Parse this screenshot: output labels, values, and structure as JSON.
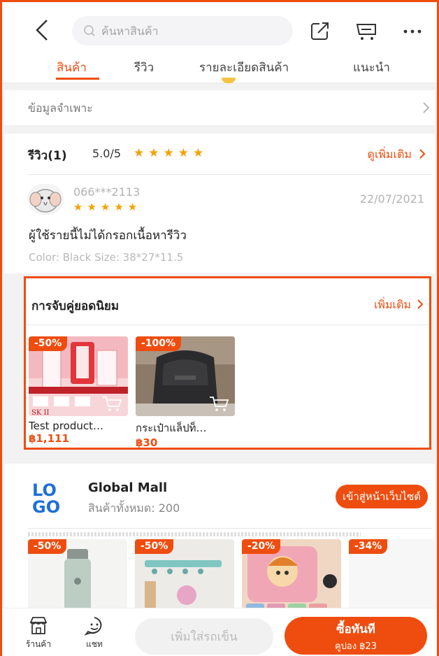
{
  "header": {
    "search_placeholder": "ค้นหาสินค้า",
    "tabs": [
      {
        "label": "สินค้า",
        "active": true
      },
      {
        "label": "รีวิว",
        "active": false
      },
      {
        "label": "รายละเอียดสินค้า",
        "active": false
      },
      {
        "label": "แนะนำ",
        "active": false
      }
    ]
  },
  "specs": {
    "label": "ข้อมูลจำเพาะ"
  },
  "reviews": {
    "title": "รีวิว(1)",
    "score": "5.0/5",
    "more_label": "ดูเพิ่มเติม",
    "rating": 5,
    "item": {
      "user": "066***2113",
      "date": "22/07/2021",
      "rating": 5,
      "text": "ผู้ใช้รายนี้ไม่ได้กรอกเนื้อหารีวิว",
      "variant": "Color: Black   Size: 38*27*11.5"
    }
  },
  "bundles": {
    "title": "การจับคู่ยอดนิยม",
    "more_label": "เพิ่มเติม",
    "products": [
      {
        "badge": "-50%",
        "name": "Test product…",
        "price": "฿1,111",
        "image_text": "SK II"
      },
      {
        "badge": "-100%",
        "name": "กระเป๋าแล็ปท็…",
        "price": "฿30"
      }
    ]
  },
  "shop": {
    "logo_text": [
      "LO",
      "GO"
    ],
    "name": "Global Mall",
    "product_count": "สินค้าทั้งหมด: 200",
    "visit_label": "เข้าสู่หน้าเว็บไซต์",
    "products": [
      {
        "badge": "-50%"
      },
      {
        "badge": "-50%"
      },
      {
        "badge": "-20%"
      },
      {
        "badge": "-34%"
      }
    ]
  },
  "bottom_bar": {
    "store_label": "ร้านค้า",
    "chat_label": "แชท",
    "add_to_cart_label": "เพิ่มใส่รถเข็น",
    "buy_now_label": "ซื้อทันที",
    "coupon_label": "คูปอง ฿23"
  },
  "colors": {
    "accent": "#ee4d0f",
    "star": "#f5a100",
    "logo_blue": "#1e6fd9"
  }
}
